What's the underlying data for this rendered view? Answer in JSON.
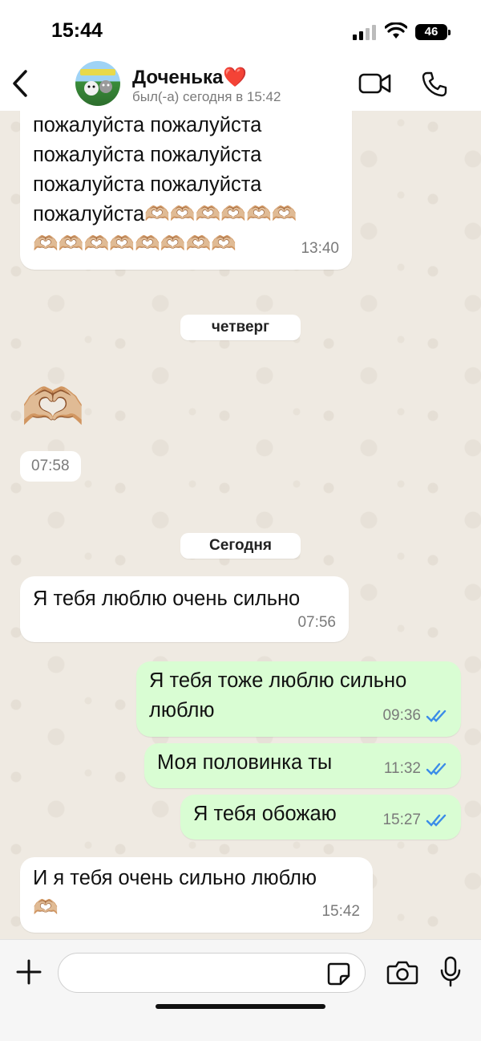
{
  "status_bar": {
    "time": "15:44",
    "battery": "46"
  },
  "header": {
    "contact_name": "Доченька❤️",
    "contact_status": "был(-а) сегодня в 15:42"
  },
  "messages": [
    {
      "direction": "in",
      "lines": [
        "пожалуйста пожалуйста",
        "пожалуйста пожалуйста",
        "пожалуйста пожалуйста",
        "пожалуйста🫶🏼🫶🏼🫶🏼🫶🏼🫶🏼🫶🏼",
        "🫶🏼🫶🏼🫶🏼🫶🏼🫶🏼🫶🏼🫶🏼🫶🏼"
      ],
      "time": "13:40"
    },
    {
      "direction": "in",
      "emoji": "🫶🏼",
      "time": "07:58"
    },
    {
      "direction": "in",
      "lines": [
        "Я тебя люблю очень сильно"
      ],
      "time": "07:56"
    },
    {
      "direction": "out",
      "lines": [
        "Я тебя тоже люблю сильно",
        "люблю"
      ],
      "time": "09:36"
    },
    {
      "direction": "out",
      "lines": [
        "Моя половинка ты"
      ],
      "time": "11:32"
    },
    {
      "direction": "out",
      "lines": [
        "Я тебя обожаю"
      ],
      "time": "15:27"
    },
    {
      "direction": "in",
      "lines": [
        "И я тебя очень сильно люблю",
        "🫶🏼"
      ],
      "time": "15:42"
    }
  ],
  "day_separators": [
    "четверг",
    "Сегодня"
  ],
  "input": {
    "placeholder": "",
    "value": ""
  },
  "colors": {
    "outgoing_bubble": "#d9fdd3",
    "incoming_bubble": "#ffffff",
    "read_ticks": "#3b8ce8"
  }
}
